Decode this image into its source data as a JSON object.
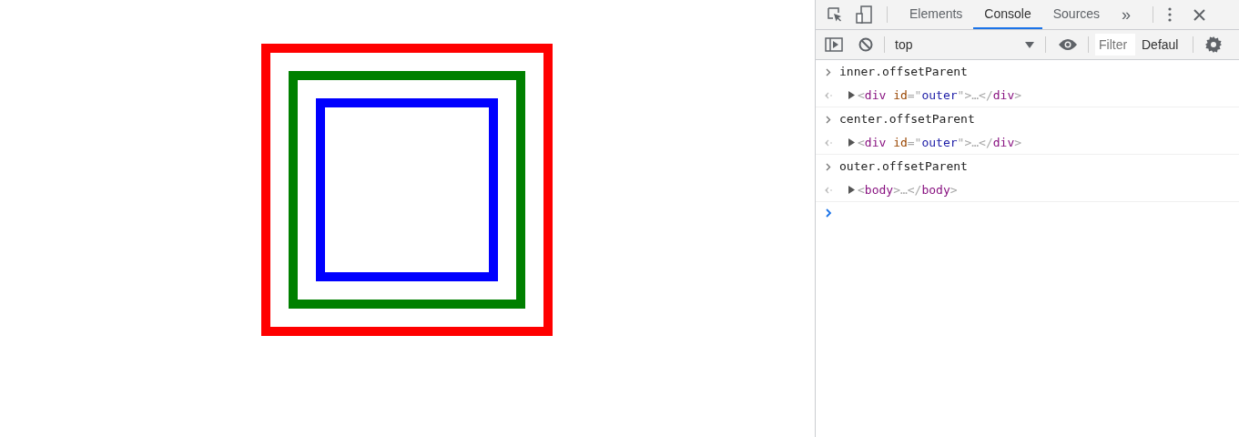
{
  "boxes": [
    {
      "color": "#ff0000"
    },
    {
      "color": "#008000"
    },
    {
      "color": "#0000ff"
    }
  ],
  "devtools": {
    "tabs": [
      {
        "label": "Elements",
        "selected": false
      },
      {
        "label": "Console",
        "selected": true
      },
      {
        "label": "Sources",
        "selected": false
      }
    ],
    "more": "»",
    "context": "top",
    "filter": {
      "placeholder": "Filter"
    },
    "levels": "Defaul",
    "entries": [
      {
        "input": "inner.offsetParent",
        "output": [
          {
            "kind": "punct",
            "text": "<"
          },
          {
            "kind": "tag",
            "text": "div"
          },
          {
            "kind": "attr",
            "text": " id"
          },
          {
            "kind": "punct",
            "text": "=\""
          },
          {
            "kind": "value",
            "text": "outer"
          },
          {
            "kind": "punct",
            "text": "\">…</"
          },
          {
            "kind": "tag",
            "text": "div"
          },
          {
            "kind": "punct",
            "text": ">"
          }
        ]
      },
      {
        "input": "center.offsetParent",
        "output": [
          {
            "kind": "punct",
            "text": "<"
          },
          {
            "kind": "tag",
            "text": "div"
          },
          {
            "kind": "attr",
            "text": " id"
          },
          {
            "kind": "punct",
            "text": "=\""
          },
          {
            "kind": "value",
            "text": "outer"
          },
          {
            "kind": "punct",
            "text": "\">…</"
          },
          {
            "kind": "tag",
            "text": "div"
          },
          {
            "kind": "punct",
            "text": ">"
          }
        ]
      },
      {
        "input": "outer.offsetParent",
        "output": [
          {
            "kind": "punct",
            "text": "<"
          },
          {
            "kind": "tag",
            "text": "body"
          },
          {
            "kind": "punct",
            "text": ">…</"
          },
          {
            "kind": "tag",
            "text": "body"
          },
          {
            "kind": "punct",
            "text": ">"
          }
        ]
      }
    ]
  }
}
